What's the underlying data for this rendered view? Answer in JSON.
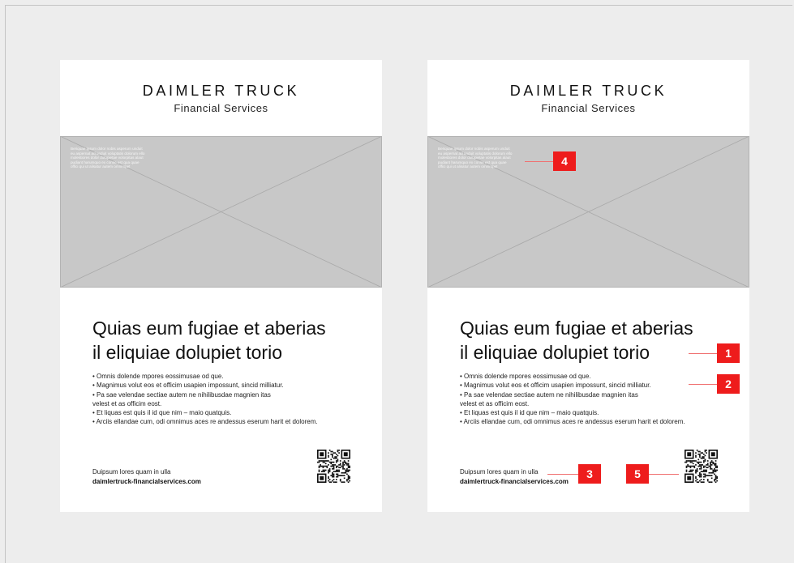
{
  "brand": {
    "name": "DAIMLER TRUCK",
    "subtitle": "Financial Services"
  },
  "hero": {
    "caption_lines": [
      "Beriquae ipsum dolor nobis asperum unduit",
      "eu aspernat ad unduit voluptatis dolorum ello",
      "molestiores dolor dolupietae volorpitas alaut",
      "pudiant harumquo ex conse est qua quae",
      "offici qui ut alisatur autem omnimpet"
    ]
  },
  "headline": {
    "line1": "Quias eum fugiae et aberias",
    "line2": "il eliquiae dolupiet torio"
  },
  "bullets": [
    "• Omnis dolende mpores eossimusae od que.",
    "• Magnimus volut eos et officim usapien impossunt, sincid milliatur.",
    "• Pa sae velendae sectiae autem ne nihilibusdae magnien itas",
    "velest et as officim eost.",
    "• Et liquas est quis il id que nim – maio quatquis.",
    "• Arciis ellandae cum, odi omnimus aces re andessus eserum harit et dolorem."
  ],
  "footer": {
    "text": "Duipsum lores quam in ulla",
    "url": "daimlertruck-financialservices.com"
  },
  "markers": [
    "1",
    "2",
    "3",
    "4",
    "5"
  ],
  "colors": {
    "marker": "#ee1c1c",
    "hero": "#c8c8c8",
    "background": "#ededed"
  }
}
